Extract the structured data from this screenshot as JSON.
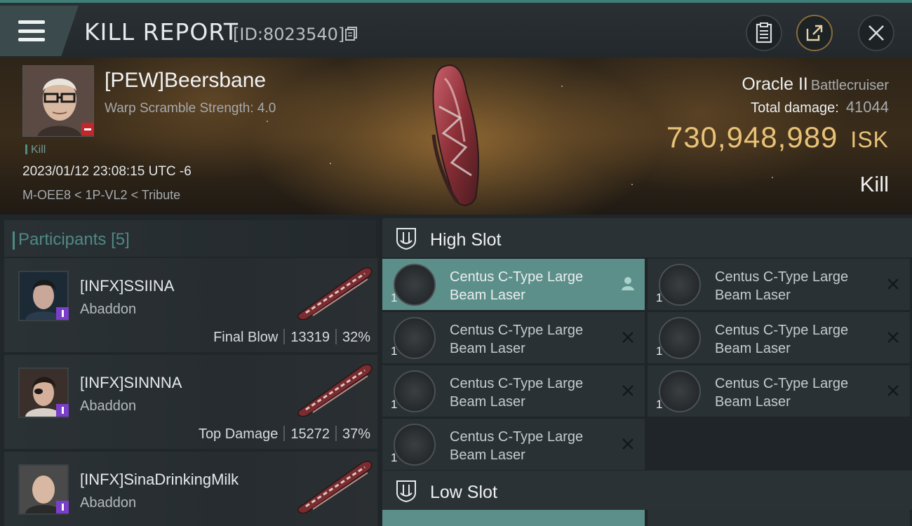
{
  "header": {
    "title": "KILL REPORT",
    "id_label": "[ID:8023540]"
  },
  "victim": {
    "name": "[PEW]Beersbane",
    "warp_scramble": "Warp Scramble Strength: 4.0",
    "tag": "Kill",
    "datetime": "2023/01/12 23:08:15 UTC -6",
    "location": "M-OEE8 < 1P-VL2 < Tribute",
    "ship_name": "Oracle II",
    "ship_class": "Battlecruiser",
    "total_damage_label": "Total damage:",
    "total_damage_value": "41044",
    "isk_value": "730,948,989",
    "isk_unit": "ISK",
    "result": "Kill"
  },
  "participants": {
    "label": "Participants",
    "count": "[5]",
    "items": [
      {
        "name": "[INFX]SSIINA",
        "ship": "Abaddon",
        "role": "Final Blow",
        "damage": "13319",
        "percent": "32%"
      },
      {
        "name": "[INFX]SINNNA",
        "ship": "Abaddon",
        "role": "Top Damage",
        "damage": "15272",
        "percent": "37%"
      },
      {
        "name": "[INFX]SinaDrinkingMilk",
        "ship": "Abaddon",
        "role": "",
        "damage": "",
        "percent": ""
      }
    ]
  },
  "slots": {
    "high": {
      "label": "High Slot",
      "modules": [
        {
          "name_line1": "Centus C-Type Large",
          "name_line2": "Beam Laser",
          "qty": "1",
          "state": "active"
        },
        {
          "name_line1": "Centus C-Type Large",
          "name_line2": "Beam Laser",
          "qty": "1",
          "state": "destroyed"
        },
        {
          "name_line1": "Centus C-Type Large",
          "name_line2": "Beam Laser",
          "qty": "1",
          "state": "destroyed"
        },
        {
          "name_line1": "Centus C-Type Large",
          "name_line2": "Beam Laser",
          "qty": "1",
          "state": "destroyed"
        },
        {
          "name_line1": "Centus C-Type Large",
          "name_line2": "Beam Laser",
          "qty": "1",
          "state": "destroyed"
        },
        {
          "name_line1": "Centus C-Type Large",
          "name_line2": "Beam Laser",
          "qty": "1",
          "state": "destroyed"
        },
        {
          "name_line1": "Centus C-Type Large",
          "name_line2": "Beam Laser",
          "qty": "1",
          "state": "destroyed"
        }
      ]
    },
    "low": {
      "label": "Low Slot"
    }
  },
  "colors": {
    "accent_teal": "#4e8a84",
    "isk_gold": "#e8c277",
    "active_slot": "#5d8f8a",
    "victim_badge": "#c0282d",
    "corp_badge": "#7a3fc9"
  },
  "icons": {
    "menu": "hamburger-icon",
    "copy": "copy-icon",
    "clipboard": "clipboard-icon",
    "share": "share-icon",
    "close": "close-icon",
    "slot": "shield-slot-icon",
    "pilot": "pilot-icon",
    "destroyed": "x-mark-icon"
  }
}
